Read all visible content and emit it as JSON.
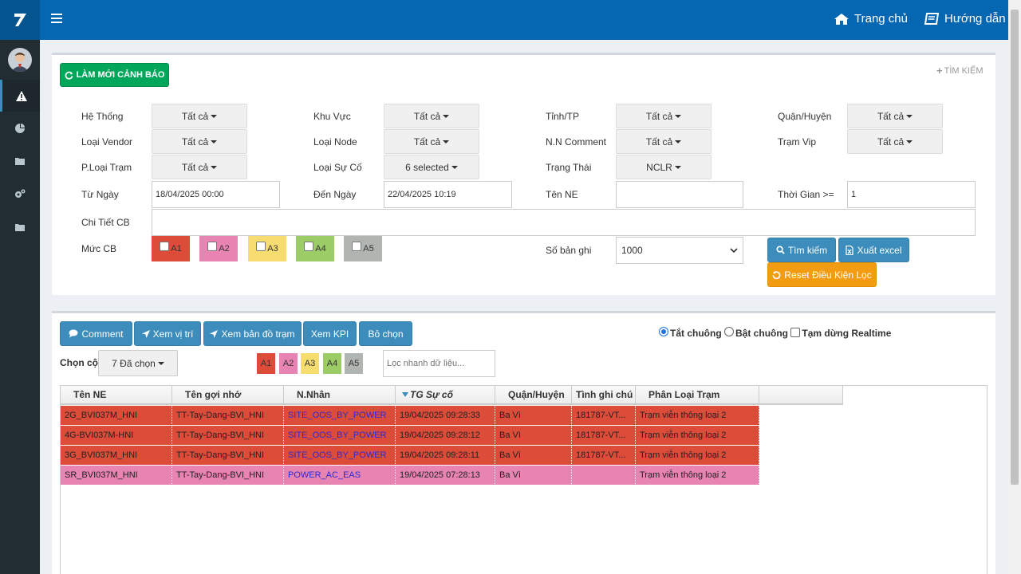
{
  "colors": {
    "header": "#0567b1",
    "sidebar": "#222d32",
    "a1": "#dd4b39",
    "a2": "#e784b1",
    "a3": "#f7dc6f",
    "a4": "#9ccc65",
    "a5": "#b0b5b2"
  },
  "header": {
    "home_label": "Trang chủ",
    "guide_label": "Hướng dẫn",
    "home_icon": "home-icon",
    "guide_icon": "book-icon"
  },
  "sidebar": {
    "items": [
      "warning-icon",
      "pie-chart-icon",
      "folder-icon",
      "gears-icon",
      "folder-icon"
    ]
  },
  "toolbar": {
    "refresh_label": "LÀM MỚI CẢNH BÁO",
    "search_toggle_label": "TÌM KIẾM"
  },
  "filters": {
    "he_thong": {
      "label": "Hệ Thống",
      "value": "Tất cả"
    },
    "khu_vuc": {
      "label": "Khu Vực",
      "value": "Tất cả"
    },
    "tinh_tp": {
      "label": "Tỉnh/TP",
      "value": "Tất cả"
    },
    "quan_huyen": {
      "label": "Quận/Huyện",
      "value": "Tất cả"
    },
    "loai_vendor": {
      "label": "Loại Vendor",
      "value": "Tất cả"
    },
    "loai_node": {
      "label": "Loại Node",
      "value": "Tất cả"
    },
    "nn_comment": {
      "label": "N.N Comment",
      "value": "Tất cả"
    },
    "tram_vip": {
      "label": "Trạm Vip",
      "value": "Tất cả"
    },
    "ploai_tram": {
      "label": "P.Loại Trạm",
      "value": "Tất cả"
    },
    "loai_su_co": {
      "label": "Loại Sự Cố",
      "value": "6 selected"
    },
    "trang_thai": {
      "label": "Trạng Thái",
      "value": "NCLR"
    },
    "tu_ngay": {
      "label": "Từ Ngày",
      "value": "18/04/2025 00:00"
    },
    "den_ngay": {
      "label": "Đến Ngày",
      "value": "22/04/2025 10:19"
    },
    "ten_ne": {
      "label": "Tên NE",
      "value": ""
    },
    "thoi_gian": {
      "label": "Thời Gian >=",
      "value": "1"
    },
    "chi_tiet_cb": {
      "label": "Chi Tiết CB",
      "value": ""
    },
    "muc_cb": {
      "label": "Mức CB",
      "levels": [
        "A1",
        "A2",
        "A3",
        "A4",
        "A5"
      ]
    },
    "so_ban_ghi": {
      "label": "Số bản ghi",
      "value": "1000"
    }
  },
  "actions": {
    "search_label": "Tìm kiếm",
    "excel_label": "Xuất excel",
    "reset_label": "Reset Điều Kiện Lọc"
  },
  "panel2": {
    "buttons": [
      "Comment",
      "Xem vị trí",
      "Xem bản đồ trạm",
      "Xem KPI",
      "Bỏ chọn"
    ],
    "radio_all_off": "Tắt chuông",
    "radio_on": "Bật chuông",
    "pause_realtime": "Tạm dừng Realtime",
    "choose_col_label": "Chọn cột",
    "choose_col_value": "7 Đã chọn",
    "levels": [
      "A1",
      "A2",
      "A3",
      "A4",
      "A5"
    ],
    "quick_filter_placeholder": "Lọc nhanh dữ liệu..."
  },
  "grid": {
    "columns": [
      "Tên NE",
      "Tên gợi nhớ",
      "N.Nhân",
      "TG Sự cố",
      "Quận/Huyện",
      "Tình ghi chú",
      "Phân Loại Trạm"
    ],
    "rows": [
      {
        "level": "A1",
        "cells": [
          "2G_BVI037M_HNI",
          "TT-Tay-Dang-BVI_HNI",
          "SITE_OOS_BY_POWER",
          "19/04/2025 09:28:33",
          "Ba Vì",
          "181787-VT...",
          "Trạm viễn thông loại 2"
        ]
      },
      {
        "level": "A1",
        "cells": [
          "4G-BVI037M-HNI",
          "TT-Tay-Dang-BVI_HNI",
          "SITE_OOS_BY_POWER",
          "19/04/2025 09:28:12",
          "Ba Vì",
          "181787-VT...",
          "Trạm viễn thông loại 2"
        ]
      },
      {
        "level": "A1",
        "cells": [
          "3G_BVI037M_HNI",
          "TT-Tay-Dang-BVI_HNI",
          "SITE_OOS_BY_POWER",
          "19/04/2025 09:28:11",
          "Ba Vì",
          "181787-VT...",
          "Trạm viễn thông loại 2"
        ]
      },
      {
        "level": "A2",
        "cells": [
          "SR_BVI037M_HNI",
          "TT-Tay-Dang-BVI_HNI",
          "POWER_AC_EAS",
          "19/04/2025 07:28:13",
          "Ba Vì",
          "",
          "Trạm viễn thông loại 2"
        ]
      }
    ]
  }
}
